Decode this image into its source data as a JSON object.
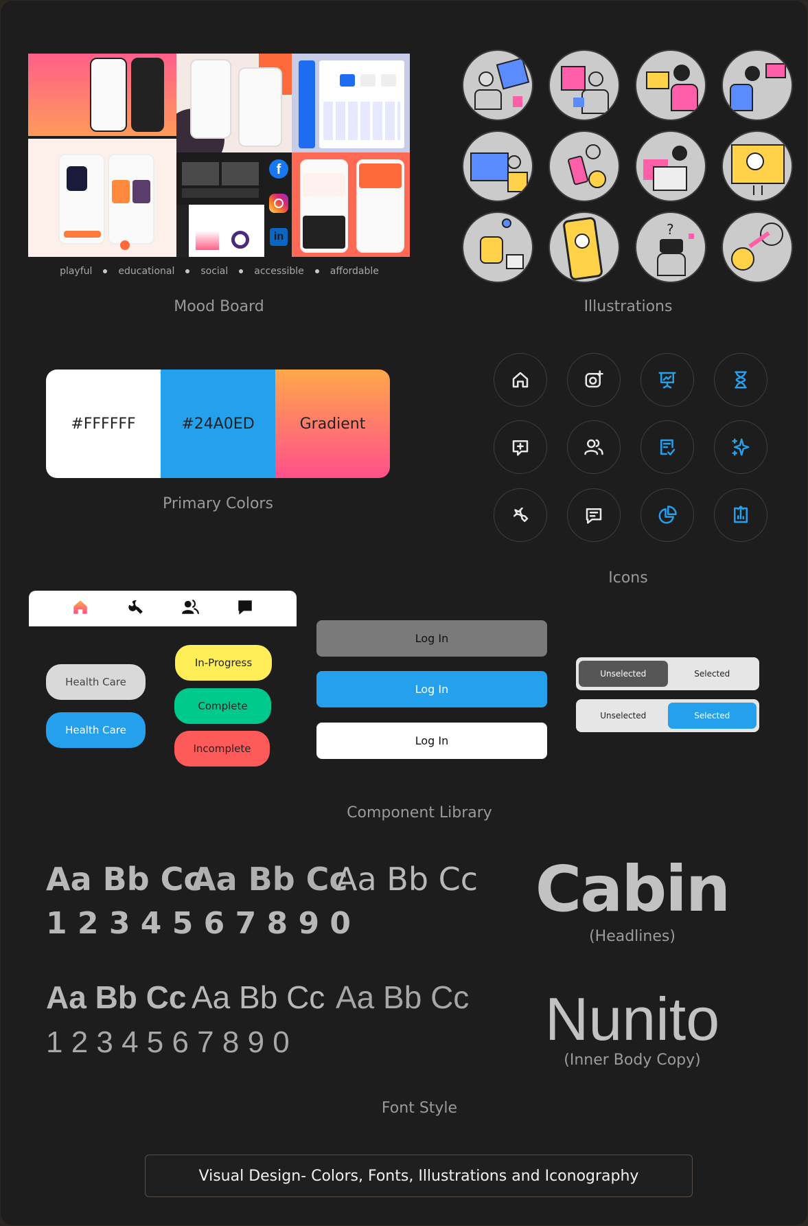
{
  "mood_board": {
    "title": "Mood Board",
    "tags": [
      "playful",
      "educational",
      "social",
      "accessible",
      "affordable"
    ],
    "social_icons": [
      "facebook-icon",
      "instagram-icon",
      "linkedin-icon"
    ]
  },
  "illustrations": {
    "title": "Illustrations",
    "count": 12
  },
  "primary_colors": {
    "title": "Primary Colors",
    "swatches": [
      {
        "label": "#FFFFFF",
        "color": "#FFFFFF"
      },
      {
        "label": "#24A0ED",
        "color": "#24A0ED"
      },
      {
        "label": "Gradient",
        "from": "#FFA84A",
        "to": "#FF4F8B"
      }
    ]
  },
  "icons": {
    "title": "Icons",
    "items": [
      {
        "name": "home-icon",
        "color": "white"
      },
      {
        "name": "camera-add-icon",
        "color": "white"
      },
      {
        "name": "presentation-icon",
        "color": "blue"
      },
      {
        "name": "hourglass-icon",
        "color": "blue"
      },
      {
        "name": "message-add-icon",
        "color": "white"
      },
      {
        "name": "users-icon",
        "color": "white"
      },
      {
        "name": "task-check-icon",
        "color": "blue"
      },
      {
        "name": "sparkle-icon",
        "color": "blue"
      },
      {
        "name": "wrench-icon",
        "color": "white"
      },
      {
        "name": "chat-icon",
        "color": "white"
      },
      {
        "name": "pie-chart-icon",
        "color": "blue"
      },
      {
        "name": "upload-chart-icon",
        "color": "blue"
      }
    ]
  },
  "component_library": {
    "title": "Component Library",
    "navbar": [
      "home-icon",
      "wrench-icon",
      "users-icon",
      "chat-icon"
    ],
    "chips": {
      "health_care_grey": "Health Care",
      "health_care_blue": "Health Care",
      "in_progress": "In-Progress",
      "complete": "Complete",
      "incomplete": "Incomplete"
    },
    "buttons": {
      "login_disabled": "Log In",
      "login_primary": "Log In",
      "login_outline": "Log In"
    },
    "segmented": {
      "row1": {
        "left": "Unselected",
        "right": "Selected"
      },
      "row2": {
        "left": "Unselected",
        "right": "Selected"
      }
    },
    "colors": {
      "blue": "#24A0ED",
      "yellow": "#FFEE57",
      "green": "#00C98D",
      "red": "#FF5A5A",
      "grey_chip": "#D9D9D9",
      "grey_button": "#7A7A7A"
    }
  },
  "font_style": {
    "title": "Font Style",
    "cabin": {
      "samples": [
        "Aa Bb Cc",
        "Aa Bb Cc",
        "Aa Bb Cc"
      ],
      "digits": "1 2 3 4 5 6 7 8 9 0",
      "name": "Cabin",
      "usage": "(Headlines)"
    },
    "nunito": {
      "samples": [
        "Aa Bb Cc",
        "Aa Bb Cc",
        "Aa Bb Cc"
      ],
      "digits": "1 2 3 4 5 6 7 8 9 0",
      "name": "Nunito",
      "usage": "(Inner Body Copy)"
    }
  },
  "footer": {
    "label": "Visual Design- Colors, Fonts, Illustrations and Iconography"
  }
}
